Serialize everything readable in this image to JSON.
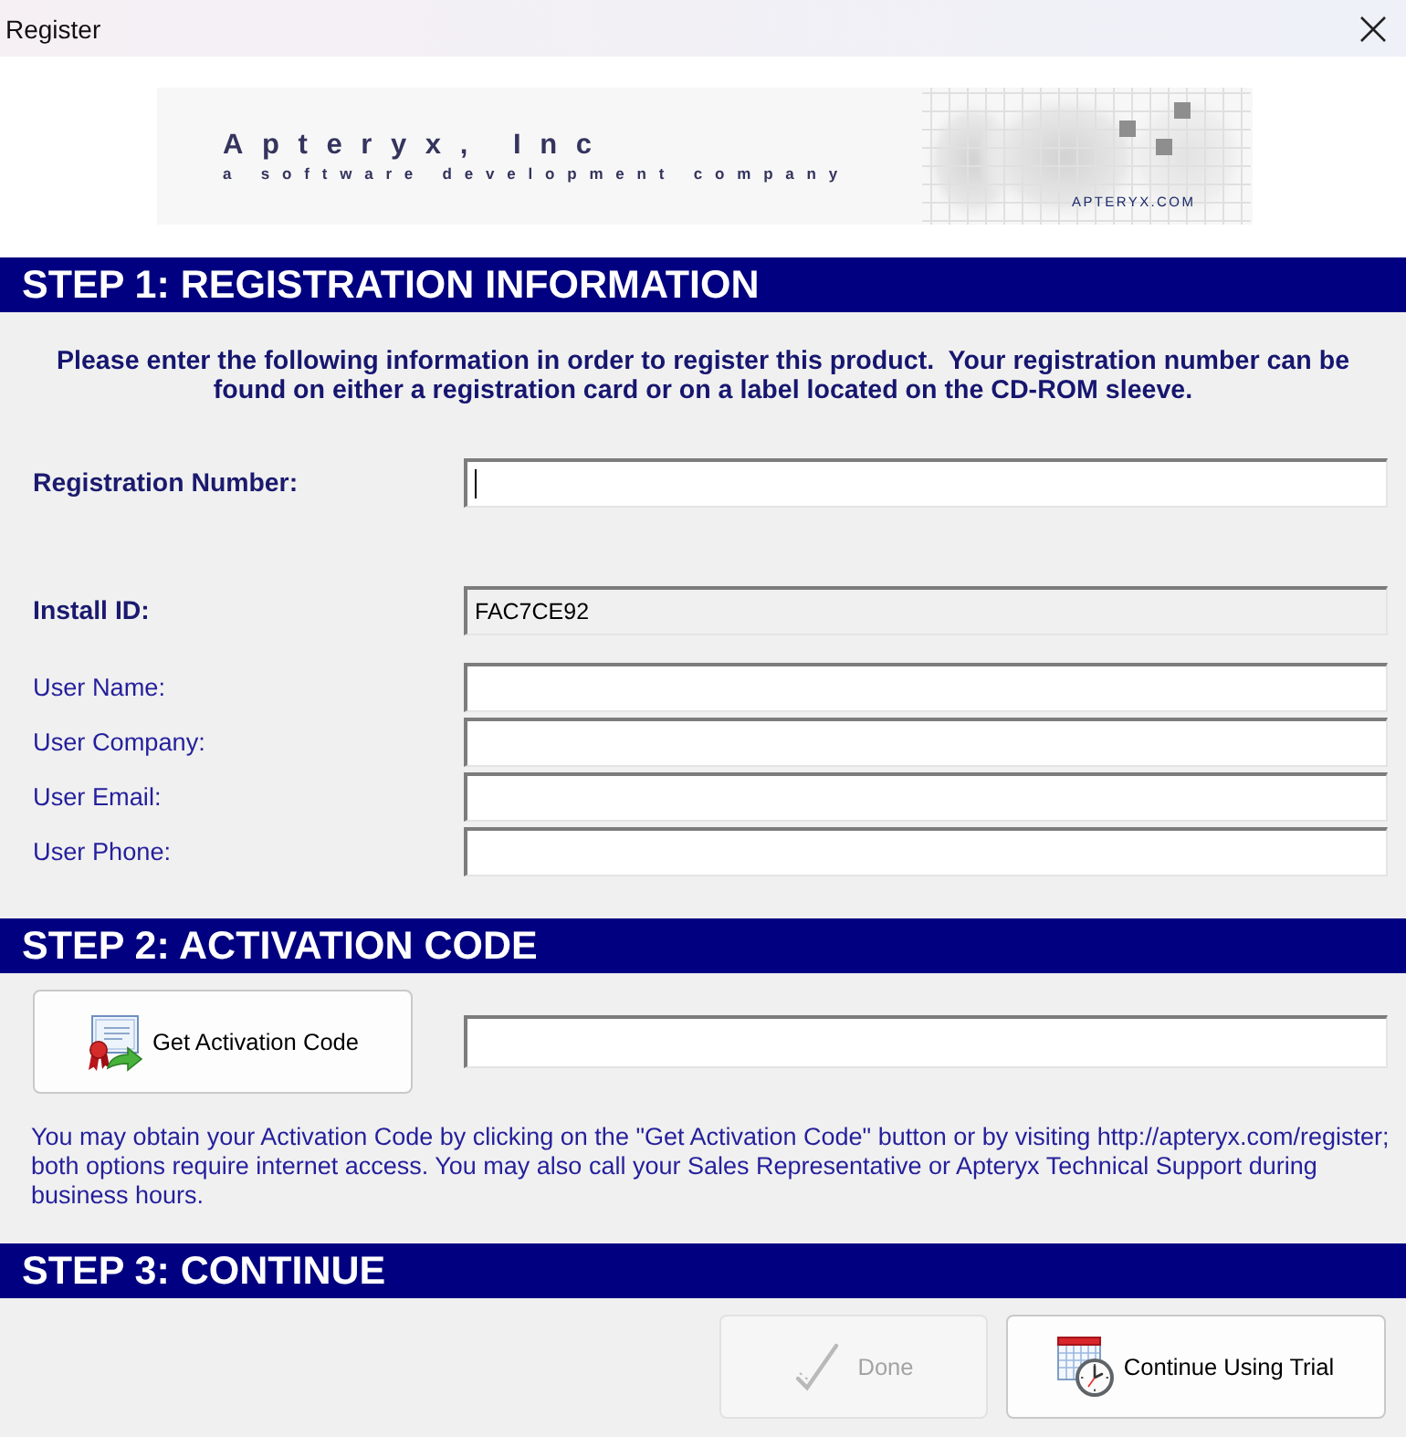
{
  "window": {
    "title": "Register"
  },
  "banner": {
    "company": "Apteryx, Inc",
    "tagline": "a software development company",
    "website": "APTERYX.COM"
  },
  "step1": {
    "title": "STEP 1: REGISTRATION INFORMATION",
    "intro": "Please enter the following information in order to register this product.  Your registration number can be found on either a registration card or on a label located on the CD-ROM sleeve.",
    "fields": [
      {
        "kind": "key-entry",
        "label": "Registration Number:",
        "focused": true
      },
      {
        "kind": "readonly",
        "label": "Install ID:",
        "value": "FAC7CE92",
        "focused": false
      },
      {
        "kind": "entry",
        "label": "User Name:",
        "focused": false
      },
      {
        "kind": "entry",
        "label": "User Company:",
        "focused": false
      },
      {
        "kind": "entry",
        "label": "User Email:",
        "focused": false
      },
      {
        "kind": "entry",
        "label": "User Phone:",
        "focused": false
      }
    ]
  },
  "step2": {
    "title": "STEP 2: ACTIVATION CODE",
    "button": {
      "kind": "certificate",
      "label": "Get Activation Code",
      "disabled": false
    },
    "note": "You may obtain your Activation Code by clicking on the \"Get Activation Code\" button or by visiting http://apteryx.com/register; both options require internet access. You may also call your Sales Representative or Apteryx Technical Support during business hours."
  },
  "step3": {
    "title": "STEP 3: CONTINUE",
    "buttons": [
      {
        "kind": "done",
        "label": "Done",
        "disabled": true
      },
      {
        "kind": "trial",
        "label": "Continue Using Trial",
        "disabled": false
      }
    ]
  }
}
